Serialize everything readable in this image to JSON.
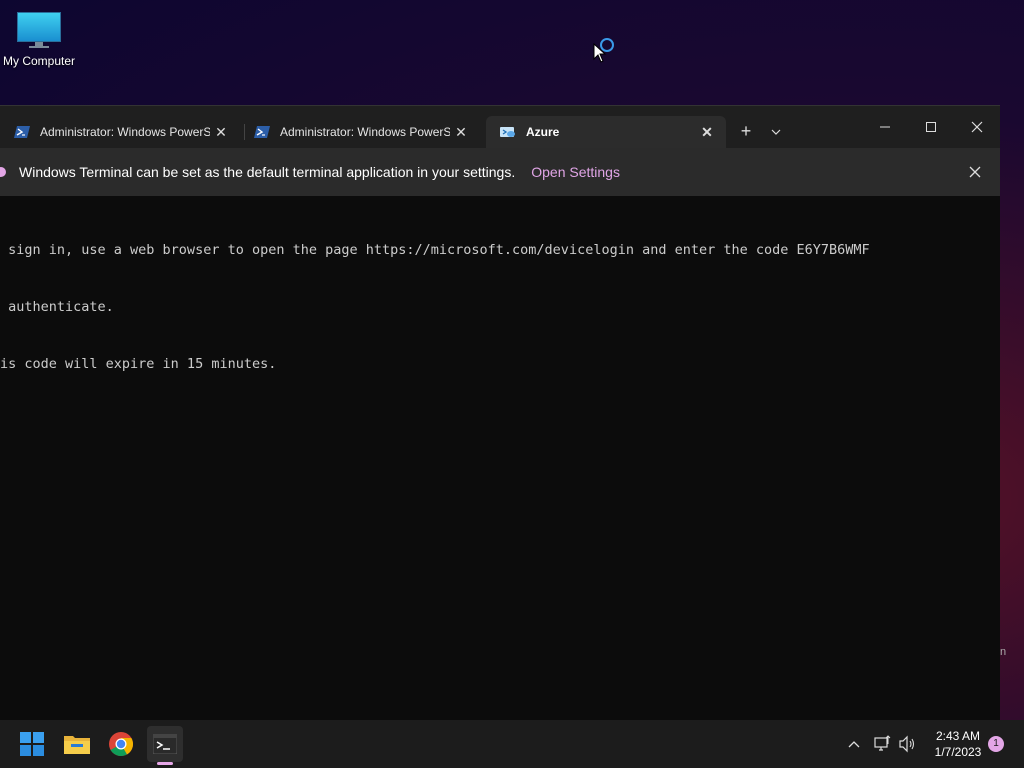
{
  "desktop": {
    "icons": [
      {
        "label": "My Computer",
        "icon": "monitor-icon"
      }
    ]
  },
  "window": {
    "tabs": [
      {
        "label": "Administrator: Windows PowerShell",
        "icon": "powershell-icon",
        "active": false
      },
      {
        "label": "Administrator: Windows PowerShell",
        "icon": "powershell-icon",
        "active": false
      },
      {
        "label": "Azure",
        "icon": "azure-cloud-shell-icon",
        "active": true
      }
    ],
    "new_tab_glyph": "+",
    "dropdown_glyph": "⌄",
    "controls": {
      "minimize": "—",
      "maximize": "☐",
      "close": "✕"
    },
    "infobar": {
      "message": "Windows Terminal can be set as the default terminal application in your settings.",
      "link": "Open Settings",
      "close": "✕"
    },
    "terminal_lines": [
      " sign in, use a web browser to open the page https://microsoft.com/devicelogin and enter the code E6Y7B6WMF",
      " authenticate.",
      "is code will expire in 15 minutes."
    ]
  },
  "side_fragment": "n",
  "taskbar": {
    "apps": [
      {
        "name": "start",
        "icon": "windows-start-icon"
      },
      {
        "name": "file-explorer",
        "icon": "folder-icon"
      },
      {
        "name": "chrome",
        "icon": "chrome-icon"
      },
      {
        "name": "terminal",
        "icon": "terminal-icon",
        "active": true
      }
    ],
    "tray": {
      "chevron": "^",
      "network_icon": "network-icon",
      "volume_icon": "volume-icon"
    },
    "clock": {
      "time": "2:43 AM",
      "date": "1/7/2023"
    },
    "notification_count": "1"
  },
  "colors": {
    "accent": "#e3a6e6",
    "terminal_bg": "#0c0c0c",
    "tabbar_bg": "#1f1f1f",
    "taskbar_bg": "#1c1c1c"
  }
}
